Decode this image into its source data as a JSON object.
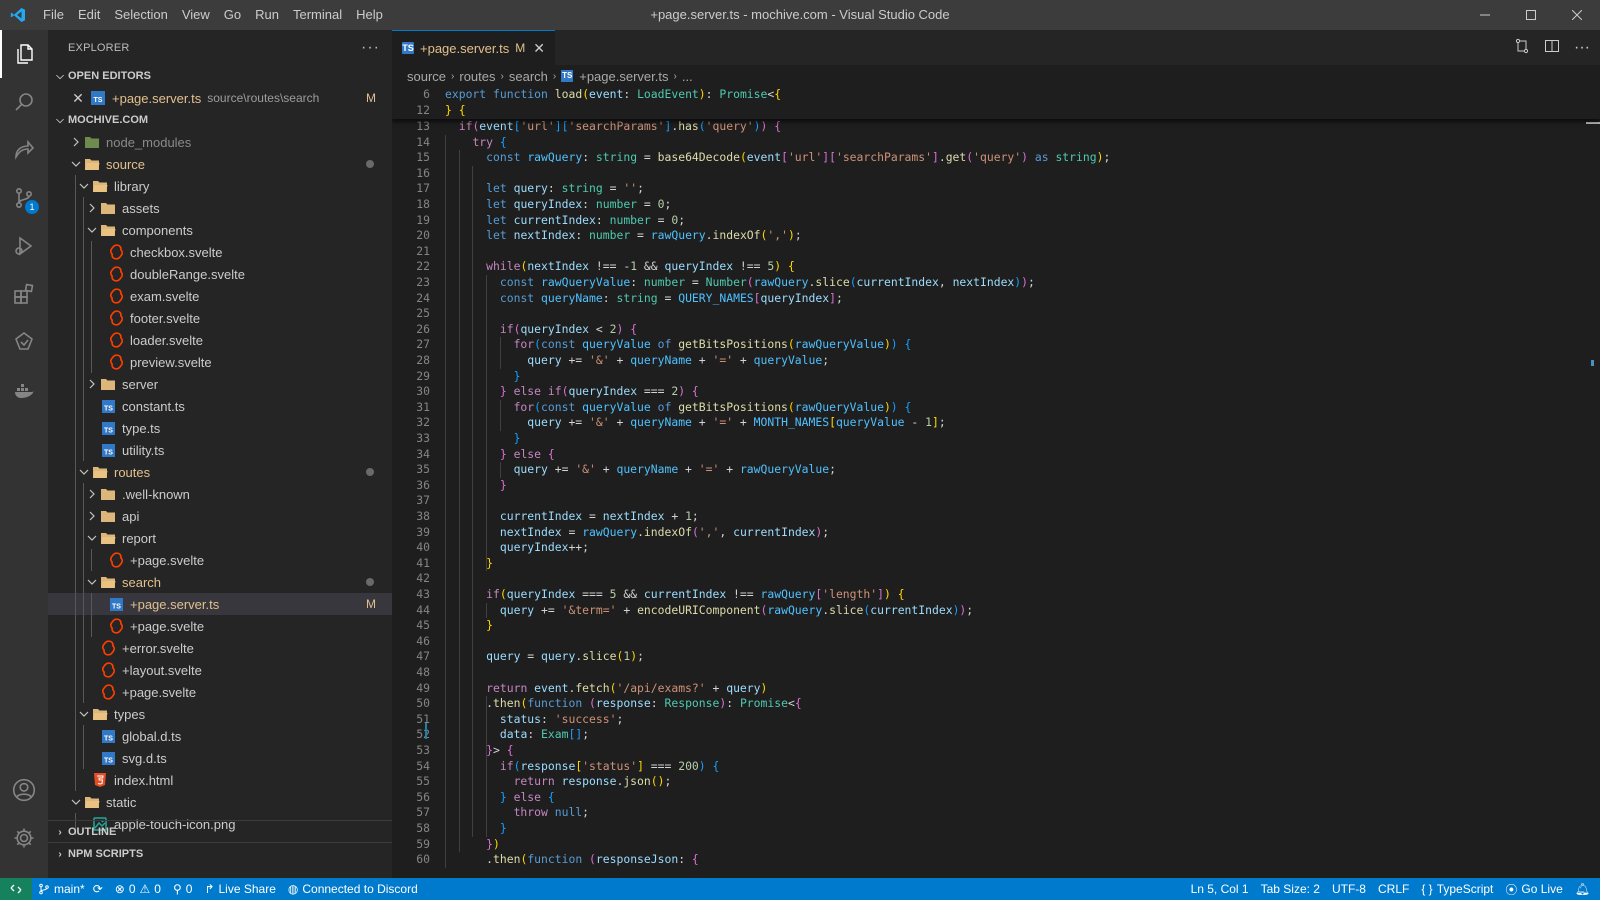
{
  "titlebar": {
    "menu": [
      "File",
      "Edit",
      "Selection",
      "View",
      "Go",
      "Run",
      "Terminal",
      "Help"
    ],
    "title": "+page.server.ts - mochive.com - Visual Studio Code"
  },
  "activitybar": {
    "scm_badge": "1"
  },
  "sidebar": {
    "header": "EXPLORER",
    "open_editors_label": "OPEN EDITORS",
    "open_editor": {
      "name": "+page.server.ts",
      "path": "source\\routes\\search",
      "status": "M"
    },
    "project_label": "MOCHIVE.COM",
    "tree": [
      {
        "name": "node_modules",
        "depth": 1,
        "kind": "folder-closed",
        "color": "#8a8a8a"
      },
      {
        "name": "source",
        "depth": 1,
        "kind": "folder-open",
        "color": "#e2c08d",
        "dot": true
      },
      {
        "name": "library",
        "depth": 2,
        "kind": "folder-open"
      },
      {
        "name": "assets",
        "depth": 3,
        "kind": "folder-closed"
      },
      {
        "name": "components",
        "depth": 3,
        "kind": "folder-open"
      },
      {
        "name": "checkbox.svelte",
        "depth": 4,
        "kind": "svelte"
      },
      {
        "name": "doubleRange.svelte",
        "depth": 4,
        "kind": "svelte"
      },
      {
        "name": "exam.svelte",
        "depth": 4,
        "kind": "svelte"
      },
      {
        "name": "footer.svelte",
        "depth": 4,
        "kind": "svelte"
      },
      {
        "name": "loader.svelte",
        "depth": 4,
        "kind": "svelte"
      },
      {
        "name": "preview.svelte",
        "depth": 4,
        "kind": "svelte"
      },
      {
        "name": "server",
        "depth": 3,
        "kind": "folder-closed"
      },
      {
        "name": "constant.ts",
        "depth": 3,
        "kind": "ts"
      },
      {
        "name": "type.ts",
        "depth": 3,
        "kind": "ts"
      },
      {
        "name": "utility.ts",
        "depth": 3,
        "kind": "ts"
      },
      {
        "name": "routes",
        "depth": 2,
        "kind": "folder-open",
        "color": "#e2c08d",
        "dot": true
      },
      {
        "name": ".well-known",
        "depth": 3,
        "kind": "folder-closed"
      },
      {
        "name": "api",
        "depth": 3,
        "kind": "folder-closed"
      },
      {
        "name": "report",
        "depth": 3,
        "kind": "folder-open"
      },
      {
        "name": "+page.svelte",
        "depth": 4,
        "kind": "svelte"
      },
      {
        "name": "search",
        "depth": 3,
        "kind": "folder-open",
        "color": "#e2c08d",
        "dot": true
      },
      {
        "name": "+page.server.ts",
        "depth": 4,
        "kind": "ts",
        "color": "#e2c08d",
        "status": "M",
        "selected": true
      },
      {
        "name": "+page.svelte",
        "depth": 4,
        "kind": "svelte"
      },
      {
        "name": "+error.svelte",
        "depth": 3,
        "kind": "svelte"
      },
      {
        "name": "+layout.svelte",
        "depth": 3,
        "kind": "svelte"
      },
      {
        "name": "+page.svelte",
        "depth": 3,
        "kind": "svelte"
      },
      {
        "name": "types",
        "depth": 2,
        "kind": "folder-open"
      },
      {
        "name": "global.d.ts",
        "depth": 3,
        "kind": "ts"
      },
      {
        "name": "svg.d.ts",
        "depth": 3,
        "kind": "ts"
      },
      {
        "name": "index.html",
        "depth": 2,
        "kind": "html"
      },
      {
        "name": "static",
        "depth": 1,
        "kind": "folder-open"
      },
      {
        "name": "apple-touch-icon.png",
        "depth": 2,
        "kind": "png"
      }
    ],
    "outline_label": "OUTLINE",
    "npm_label": "NPM SCRIPTS"
  },
  "editor": {
    "tab": {
      "name": "+page.server.ts",
      "status": "M"
    },
    "breadcrumb": [
      "source",
      "routes",
      "search",
      "+page.server.ts",
      "..."
    ],
    "sticky_lines": [
      {
        "n": "6",
        "html": "<span class='kw'>export</span> <span class='kw'>function</span> <span class='fn'>load</span><span class='b1'>(</span><span class='var'>event</span>: <span class='ty'>LoadEvent</span><span class='b1'>)</span>: <span class='ty'>Promise</span>&lt;<span class='b1'>{</span>"
      },
      {
        "n": "12",
        "html": "<span class='b1'>}</span> <span class='b1'>{</span>"
      }
    ],
    "lines": [
      {
        "n": "13",
        "html": "  <span class='ctl'>if</span><span class='b2'>(</span><span class='var'>event</span><span class='b3'>[</span><span class='str'>'url'</span><span class='b3'>]</span><span class='b3'>[</span><span class='str'>'searchParams'</span><span class='b3'>]</span>.<span class='fn'>has</span><span class='b3'>(</span><span class='str'>'query'</span><span class='b3'>)</span><span class='b2'>)</span> <span class='b2'>{</span>"
      },
      {
        "n": "14",
        "html": "    <span class='ctl'>try</span> <span class='b3'>{</span>"
      },
      {
        "n": "15",
        "html": "      <span class='kw'>const</span> <span class='cn'>rawQuery</span>: <span class='ty'>string</span> = <span class='fn'>base64Decode</span><span class='b1'>(</span><span class='var'>event</span><span class='b2'>[</span><span class='str'>'url'</span><span class='b2'>]</span><span class='b2'>[</span><span class='str'>'searchParams'</span><span class='b2'>]</span>.<span class='fn'>get</span><span class='b2'>(</span><span class='str'>'query'</span><span class='b2'>)</span> <span class='kw'>as</span> <span class='ty'>string</span><span class='b1'>)</span>;"
      },
      {
        "n": "16",
        "html": ""
      },
      {
        "n": "17",
        "html": "      <span class='kw'>let</span> <span class='var'>query</span>: <span class='ty'>string</span> = <span class='str'>''</span>;"
      },
      {
        "n": "18",
        "html": "      <span class='kw'>let</span> <span class='var'>queryIndex</span>: <span class='ty'>number</span> = <span class='num'>0</span>;"
      },
      {
        "n": "19",
        "html": "      <span class='kw'>let</span> <span class='var'>currentIndex</span>: <span class='ty'>number</span> = <span class='num'>0</span>;"
      },
      {
        "n": "20",
        "html": "      <span class='kw'>let</span> <span class='var'>nextIndex</span>: <span class='ty'>number</span> = <span class='cn'>rawQuery</span>.<span class='fn'>indexOf</span><span class='b1'>(</span><span class='str'>','</span><span class='b1'>)</span>;"
      },
      {
        "n": "21",
        "html": ""
      },
      {
        "n": "22",
        "html": "      <span class='ctl'>while</span><span class='b1'>(</span><span class='var'>nextIndex</span> !== -<span class='num'>1</span> &amp;&amp; <span class='var'>queryIndex</span> !== <span class='num'>5</span><span class='b1'>)</span> <span class='b1'>{</span>"
      },
      {
        "n": "23",
        "html": "        <span class='kw'>const</span> <span class='cn'>rawQueryValue</span>: <span class='ty'>number</span> = <span class='ty'>Number</span><span class='b2'>(</span><span class='cn'>rawQuery</span>.<span class='fn'>slice</span><span class='b3'>(</span><span class='var'>currentIndex</span>, <span class='var'>nextIndex</span><span class='b3'>)</span><span class='b2'>)</span>;"
      },
      {
        "n": "24",
        "html": "        <span class='kw'>const</span> <span class='cn'>queryName</span>: <span class='ty'>string</span> = <span class='cn'>QUERY_NAMES</span><span class='b2'>[</span><span class='var'>queryIndex</span><span class='b2'>]</span>;"
      },
      {
        "n": "25",
        "html": ""
      },
      {
        "n": "26",
        "html": "        <span class='ctl'>if</span><span class='b2'>(</span><span class='var'>queryIndex</span> &lt; <span class='num'>2</span><span class='b2'>)</span> <span class='b2'>{</span>"
      },
      {
        "n": "27",
        "html": "          <span class='ctl'>for</span><span class='b3'>(</span><span class='kw'>const</span> <span class='cn'>queryValue</span> <span class='kw'>of</span> <span class='fn'>getBitsPositions</span><span class='b1'>(</span><span class='cn'>rawQueryValue</span><span class='b1'>)</span><span class='b3'>)</span> <span class='b3'>{</span>"
      },
      {
        "n": "28",
        "html": "            <span class='var'>query</span> += <span class='str'>'&amp;'</span> + <span class='cn'>queryName</span> + <span class='str'>'='</span> + <span class='cn'>queryValue</span>;"
      },
      {
        "n": "29",
        "html": "          <span class='b3'>}</span>"
      },
      {
        "n": "30",
        "html": "        <span class='b2'>}</span> <span class='ctl'>else</span> <span class='ctl'>if</span><span class='b2'>(</span><span class='var'>queryIndex</span> === <span class='num'>2</span><span class='b2'>)</span> <span class='b2'>{</span>"
      },
      {
        "n": "31",
        "html": "          <span class='ctl'>for</span><span class='b3'>(</span><span class='kw'>const</span> <span class='cn'>queryValue</span> <span class='kw'>of</span> <span class='fn'>getBitsPositions</span><span class='b1'>(</span><span class='cn'>rawQueryValue</span><span class='b1'>)</span><span class='b3'>)</span> <span class='b3'>{</span>"
      },
      {
        "n": "32",
        "html": "            <span class='var'>query</span> += <span class='str'>'&amp;'</span> + <span class='cn'>queryName</span> + <span class='str'>'='</span> + <span class='cn'>MONTH_NAMES</span><span class='b1'>[</span><span class='cn'>queryValue</span> - <span class='num'>1</span><span class='b1'>]</span>;"
      },
      {
        "n": "33",
        "html": "          <span class='b3'>}</span>"
      },
      {
        "n": "34",
        "html": "        <span class='b2'>}</span> <span class='ctl'>else</span> <span class='b2'>{</span>"
      },
      {
        "n": "35",
        "html": "          <span class='var'>query</span> += <span class='str'>'&amp;'</span> + <span class='cn'>queryName</span> + <span class='str'>'='</span> + <span class='cn'>rawQueryValue</span>;"
      },
      {
        "n": "36",
        "html": "        <span class='b2'>}</span>"
      },
      {
        "n": "37",
        "html": ""
      },
      {
        "n": "38",
        "html": "        <span class='var'>currentIndex</span> = <span class='var'>nextIndex</span> + <span class='num'>1</span>;"
      },
      {
        "n": "39",
        "html": "        <span class='var'>nextIndex</span> = <span class='cn'>rawQuery</span>.<span class='fn'>indexOf</span><span class='b2'>(</span><span class='str'>','</span>, <span class='var'>currentIndex</span><span class='b2'>)</span>;"
      },
      {
        "n": "40",
        "html": "        <span class='var'>queryIndex</span>++;"
      },
      {
        "n": "41",
        "html": "      <span class='b1'>}</span>"
      },
      {
        "n": "42",
        "html": ""
      },
      {
        "n": "43",
        "html": "      <span class='ctl'>if</span><span class='b1'>(</span><span class='var'>queryIndex</span> === <span class='num'>5</span> &amp;&amp; <span class='var'>currentIndex</span> !== <span class='cn'>rawQuery</span><span class='b2'>[</span><span class='str'>'length'</span><span class='b2'>]</span><span class='b1'>)</span> <span class='b1'>{</span>"
      },
      {
        "n": "44",
        "html": "        <span class='var'>query</span> += <span class='str'>'&amp;term='</span> + <span class='fn'>encodeURIComponent</span><span class='b2'>(</span><span class='cn'>rawQuery</span>.<span class='fn'>slice</span><span class='b3'>(</span><span class='var'>currentIndex</span><span class='b3'>)</span><span class='b2'>)</span>;"
      },
      {
        "n": "45",
        "html": "      <span class='b1'>}</span>"
      },
      {
        "n": "46",
        "html": ""
      },
      {
        "n": "47",
        "html": "      <span class='var'>query</span> = <span class='var'>query</span>.<span class='fn'>slice</span><span class='b1'>(</span><span class='num'>1</span><span class='b1'>)</span>;"
      },
      {
        "n": "48",
        "html": ""
      },
      {
        "n": "49",
        "html": "      <span class='ctl'>return</span> <span class='var'>event</span>.<span class='fn'>fetch</span><span class='b1'>(</span><span class='str'>'/api/exams?'</span> + <span class='var'>query</span><span class='b1'>)</span>"
      },
      {
        "n": "50",
        "html": "      .<span class='fn'>then</span><span class='b1'>(</span><span class='kw'>function</span> <span class='b2'>(</span><span class='var'>response</span>: <span class='ty'>Response</span><span class='b2'>)</span>: <span class='ty'>Promise</span>&lt;<span class='b2'>{</span>"
      },
      {
        "n": "51",
        "html": "        <span class='var'>status</span>: <span class='str'>'success'</span>;"
      },
      {
        "n": "52",
        "html": "        <span class='var'>data</span>: <span class='ty'>Exam</span><span class='b3'>[]</span>;"
      },
      {
        "n": "53",
        "html": "      <span class='b2'>}</span>&gt; <span class='b2'>{</span>"
      },
      {
        "n": "54",
        "html": "        <span class='ctl'>if</span><span class='b3'>(</span><span class='var'>response</span><span class='b1'>[</span><span class='str'>'status'</span><span class='b1'>]</span> === <span class='num'>200</span><span class='b3'>)</span> <span class='b3'>{</span>"
      },
      {
        "n": "55",
        "html": "          <span class='ctl'>return</span> <span class='var'>response</span>.<span class='fn'>json</span><span class='b1'>()</span>;"
      },
      {
        "n": "56",
        "html": "        <span class='b3'>}</span> <span class='ctl'>else</span> <span class='b3'>{</span>"
      },
      {
        "n": "57",
        "html": "          <span class='ctl'>throw</span> <span class='kw'>null</span>;"
      },
      {
        "n": "58",
        "html": "        <span class='b3'>}</span>"
      },
      {
        "n": "59",
        "html": "      <span class='b2'>}</span><span class='b1'>)</span>"
      },
      {
        "n": "60",
        "html": "      .<span class='fn'>then</span><span class='b1'>(</span><span class='kw'>function</span> <span class='b2'>(</span><span class='var'>responseJson</span>: <span class='b2'>{</span>"
      }
    ]
  },
  "statusbar": {
    "branch": "main*",
    "errors": "0",
    "warnings": "0",
    "ports": "0",
    "live_share": "Live Share",
    "discord": "Connected to Discord",
    "position": "Ln 5, Col 1",
    "tab_size": "Tab Size: 2",
    "encoding": "UTF-8",
    "eol": "CRLF",
    "language": "TypeScript",
    "go_live": "Go Live"
  },
  "colors": {
    "accent": "#007acc",
    "modified": "#e2c08d",
    "remote": "#16825d"
  }
}
